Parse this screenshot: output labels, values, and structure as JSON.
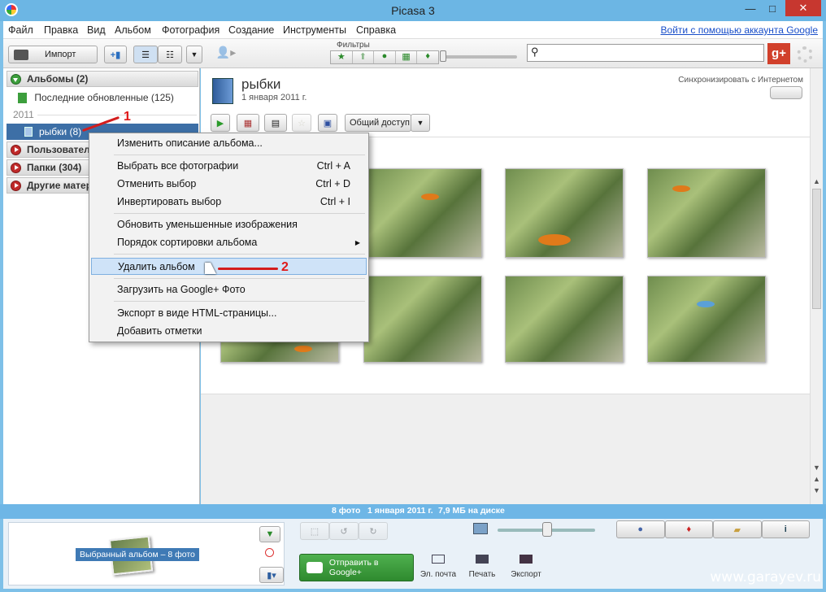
{
  "window": {
    "title": "Picasa 3",
    "minimize": "—",
    "maximize": "□",
    "close": "✕"
  },
  "menu": {
    "items": [
      "Файл",
      "Правка",
      "Вид",
      "Альбом",
      "Фотография",
      "Создание",
      "Инструменты",
      "Справка"
    ],
    "login": "Войти с помощью аккаунта Google"
  },
  "toolbar": {
    "import": "Импорт",
    "filters_label": "Фильтры"
  },
  "sidebar": {
    "albums": "Альбомы (2)",
    "recent": "Последние обновленные (125)",
    "year": "2011",
    "selected_album": "рыбки (8)",
    "users": "Пользовател",
    "folders": "Папки (304)",
    "other": "Другие матер"
  },
  "album": {
    "name": "рыбки",
    "date": "1 января 2011 г.",
    "sync": "Синхронизировать с Интернетом",
    "share": "Общий доступ"
  },
  "context_menu": {
    "edit": "Изменить описание альбома...",
    "select_all": "Выбрать все фотографии",
    "select_all_sc": "Ctrl + A",
    "deselect": "Отменить выбор",
    "deselect_sc": "Ctrl + D",
    "invert": "Инвертировать выбор",
    "invert_sc": "Ctrl + I",
    "refresh": "Обновить уменьшенные изображения",
    "sort": "Порядок сортировки альбома",
    "delete": "Удалить альбом",
    "upload": "Загрузить на Google+ Фото",
    "export": "Экспорт в виде HTML-страницы...",
    "tags": "Добавить отметки"
  },
  "annotations": {
    "one": "1",
    "two": "2"
  },
  "status": {
    "count": "8 фото",
    "date": "1 января 2011 г.",
    "size": "7,9 МБ на диске"
  },
  "bottom": {
    "selected": "Выбранный альбом – 8 фото",
    "gplus": "Отправить в Google+",
    "email": "Эл. почта",
    "print": "Печать",
    "export": "Экспорт"
  },
  "watermark": "www.garayev.ru",
  "colors": {
    "accent": "#6eb6e6",
    "annotation": "#d31d1d",
    "selection": "#cfe3f8"
  }
}
